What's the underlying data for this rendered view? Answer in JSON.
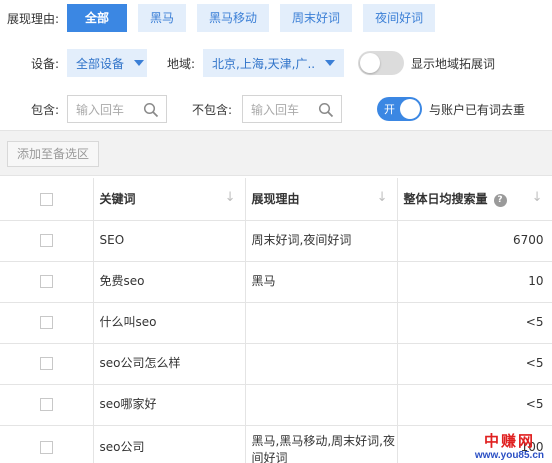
{
  "reason_filter": {
    "label": "展现理由:",
    "options": [
      {
        "label": "全部",
        "active": true
      },
      {
        "label": "黑马",
        "active": false
      },
      {
        "label": "黑马移动",
        "active": false
      },
      {
        "label": "周末好词",
        "active": false
      },
      {
        "label": "夜间好词",
        "active": false
      }
    ]
  },
  "device": {
    "label": "设备:",
    "value": "全部设备"
  },
  "region": {
    "label": "地域:",
    "value": "北京,上海,天津,广..."
  },
  "region_expand_toggle": {
    "label": "显示地域拓展词",
    "on": false
  },
  "include": {
    "label": "包含:",
    "placeholder": "输入回车"
  },
  "exclude": {
    "label": "不包含:",
    "placeholder": "输入回车"
  },
  "dedupe_toggle": {
    "label": "与账户已有词去重",
    "on": true,
    "on_text": "开"
  },
  "toolbar": {
    "add_label": "添加至备选区"
  },
  "table": {
    "headers": {
      "keyword": "关键词",
      "reason": "展现理由",
      "volume": "整体日均搜索量"
    },
    "rows": [
      {
        "keyword": "SEO",
        "reason": "周末好词,夜间好词",
        "volume": "6700"
      },
      {
        "keyword": "免费seo",
        "reason": "黑马",
        "volume": "10"
      },
      {
        "keyword": "什么叫seo",
        "reason": "",
        "volume": "<5"
      },
      {
        "keyword": "seo公司怎么样",
        "reason": "",
        "volume": "<5"
      },
      {
        "keyword": "seo哪家好",
        "reason": "",
        "volume": "<5"
      },
      {
        "keyword": "seo公司",
        "reason": "黑马,黑马移动,周末好词,夜间好词",
        "volume": "100"
      }
    ]
  },
  "watermark": {
    "title": "中赚网",
    "url": "www.you85.cn"
  },
  "colors": {
    "accent": "#3b87e3",
    "pill_bg": "#e3eefb",
    "watermark_red": "#e02020"
  }
}
